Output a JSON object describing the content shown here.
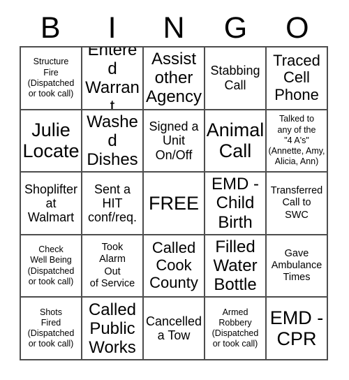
{
  "header": {
    "letters": [
      "B",
      "I",
      "N",
      "G",
      "O"
    ]
  },
  "grid": {
    "rows": 5,
    "columns": 5,
    "border_color": "#4d4d4d",
    "background_color": "#ffffff",
    "text_color": "#000000",
    "cells": [
      {
        "text": "Structure\nFire\n(Dispatched\nor took call)",
        "size": "xs",
        "free": false
      },
      {
        "text": "Entered\nWarrant",
        "size": "xl",
        "free": false
      },
      {
        "text": "Assist\nother\nAgency",
        "size": "xl",
        "free": false
      },
      {
        "text": "Stabbing\nCall",
        "size": "md",
        "free": false
      },
      {
        "text": "Traced\nCell\nPhone",
        "size": "lg",
        "free": false
      },
      {
        "text": "Julie\nLocate",
        "size": "xxl",
        "free": false
      },
      {
        "text": "Washed\nDishes",
        "size": "xl",
        "free": false
      },
      {
        "text": "Signed a\nUnit\nOn/Off",
        "size": "md",
        "free": false
      },
      {
        "text": "Animal\nCall",
        "size": "xxl",
        "free": false
      },
      {
        "text": "Talked to\nany of the\n\"4 A's\"\n(Annette, Amy,\nAlicia, Ann)",
        "size": "xs",
        "free": false
      },
      {
        "text": "Shoplifter\nat\nWalmart",
        "size": "md",
        "free": false
      },
      {
        "text": "Sent a\nHIT\nconf/req.",
        "size": "md",
        "free": false
      },
      {
        "text": "FREE",
        "size": "xxl",
        "free": true
      },
      {
        "text": "EMD -\nChild\nBirth",
        "size": "xl",
        "free": false
      },
      {
        "text": "Transferred\nCall to\nSWC",
        "size": "sm",
        "free": false
      },
      {
        "text": "Check\nWell Being\n(Dispatched\nor took call)",
        "size": "xs",
        "free": false
      },
      {
        "text": "Took\nAlarm\nOut\nof Service",
        "size": "sm",
        "free": false
      },
      {
        "text": "Called\nCook\nCounty",
        "size": "lg",
        "free": false
      },
      {
        "text": "Filled\nWater\nBottle",
        "size": "xl",
        "free": false
      },
      {
        "text": "Gave\nAmbulance\nTimes",
        "size": "sm",
        "free": false
      },
      {
        "text": "Shots\nFired\n(Dispatched\nor took call)",
        "size": "xs",
        "free": false
      },
      {
        "text": "Called\nPublic\nWorks",
        "size": "xl",
        "free": false
      },
      {
        "text": "Cancelled\na Tow",
        "size": "md",
        "free": false
      },
      {
        "text": "Armed\nRobbery\n(Dispatched\nor took call)",
        "size": "xs",
        "free": false
      },
      {
        "text": "EMD -\nCPR",
        "size": "xxl",
        "free": false
      }
    ]
  }
}
